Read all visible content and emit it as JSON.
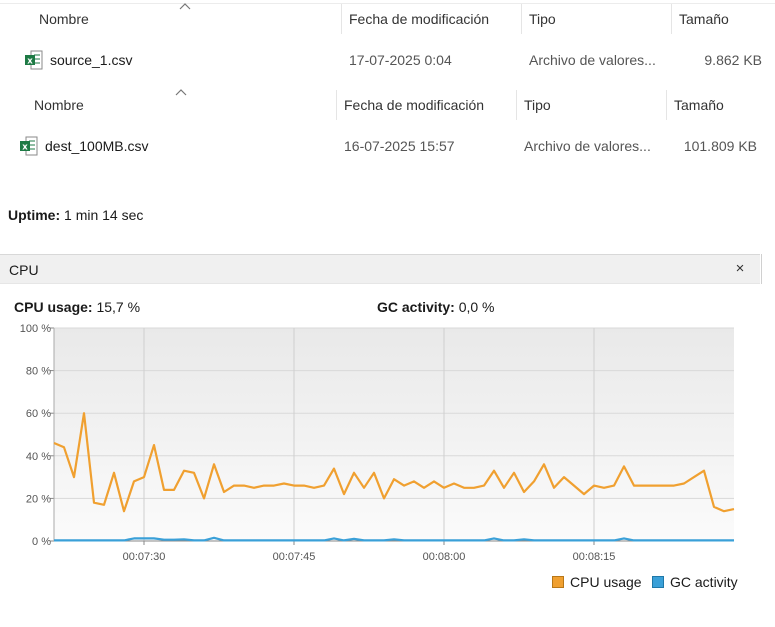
{
  "explorer": {
    "columns": {
      "name": "Nombre",
      "modified": "Fecha de modificación",
      "type": "Tipo",
      "size": "Tamaño"
    },
    "files": [
      {
        "name": "source_1.csv",
        "modified": "17-07-2025 0:04",
        "type": "Archivo de valores...",
        "size": "9.862 KB"
      },
      {
        "name": "dest_100MB.csv",
        "modified": "16-07-2025 15:57",
        "type": "Archivo de valores...",
        "size": "101.809 KB"
      }
    ]
  },
  "uptime": {
    "label": "Uptime:",
    "value": "1 min 14 sec"
  },
  "cpu_panel": {
    "title": "CPU",
    "close_icon": "×",
    "cpu_usage_label": "CPU usage:",
    "cpu_usage_value": "15,7 %",
    "gc_activity_label": "GC activity:",
    "gc_activity_value": "0,0 %"
  },
  "colors": {
    "cpu": "#f0a030",
    "gc": "#3aa0d8",
    "excel_green": "#1d7a44"
  },
  "chart_data": {
    "type": "line",
    "y_tick_labels": [
      "100 %",
      "80 %",
      "60 %",
      "40 %",
      "20 %",
      "0 %"
    ],
    "x_tick_labels": [
      "00:07:30",
      "00:07:45",
      "00:08:00",
      "00:08:15"
    ],
    "ylim": [
      0,
      100
    ],
    "grid": true,
    "legend_position": "bottom-right",
    "series": [
      {
        "name": "CPU usage",
        "values": [
          46,
          44,
          30,
          60,
          18,
          17,
          32,
          14,
          28,
          30,
          45,
          24,
          24,
          33,
          32,
          20,
          36,
          23,
          26,
          26,
          25,
          26,
          26,
          27,
          26,
          26,
          25,
          26,
          34,
          22,
          32,
          25,
          32,
          20,
          29,
          26,
          28,
          25,
          28,
          25,
          27,
          25,
          25,
          26,
          33,
          25,
          32,
          23,
          28,
          36,
          25,
          30,
          26,
          22,
          26,
          25,
          26,
          35,
          26,
          26,
          26,
          26,
          26,
          27,
          30,
          33,
          16,
          14,
          15
        ],
        "color": "#f0a030"
      },
      {
        "name": "GC activity",
        "values": [
          0.3,
          0.3,
          0.3,
          0.3,
          0.3,
          0.3,
          0.3,
          0.3,
          1.2,
          1.2,
          1.2,
          0.6,
          0.6,
          0.8,
          0.3,
          0.3,
          1.5,
          0.3,
          0.3,
          0.3,
          0.3,
          0.3,
          0.3,
          0.3,
          0.3,
          0.3,
          0.3,
          0.3,
          1.2,
          0.3,
          1.0,
          0.3,
          0.3,
          0.3,
          0.8,
          0.3,
          0.3,
          0.3,
          0.3,
          0.3,
          0.3,
          0.3,
          0.3,
          0.3,
          1.2,
          0.3,
          0.3,
          0.8,
          0.3,
          0.3,
          0.3,
          0.3,
          0.3,
          0.3,
          0.3,
          0.3,
          0.3,
          1.2,
          0.3,
          0.3,
          0.3,
          0.3,
          0.3,
          0.3,
          0.3,
          0.3,
          0.3,
          0.3,
          0.3
        ],
        "color": "#3aa0d8"
      }
    ]
  }
}
